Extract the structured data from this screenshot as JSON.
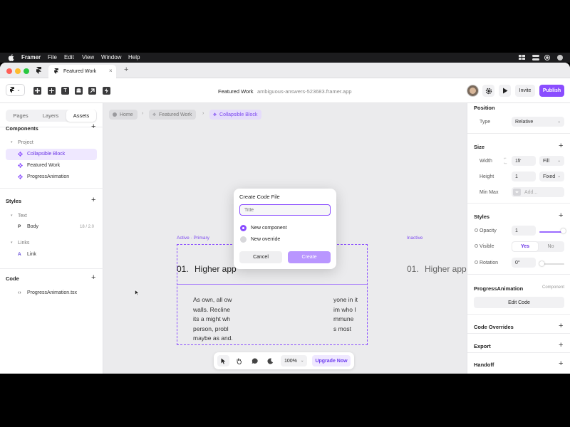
{
  "menubar": {
    "items": [
      "Framer",
      "File",
      "Edit",
      "View",
      "Window",
      "Help"
    ]
  },
  "tab": {
    "title": "Featured Work"
  },
  "toolbar": {
    "project_name": "Featured Work",
    "url": "ambiguous-answers-523683.framer.app",
    "invite_label": "Invite",
    "publish_label": "Publish"
  },
  "left": {
    "tabs": [
      "Pages",
      "Layers",
      "Assets"
    ],
    "components_title": "Components",
    "project_label": "Project",
    "components": [
      "Collapsible Block",
      "Featured Work",
      "ProgressAnimation"
    ],
    "styles_title": "Styles",
    "text_label": "Text",
    "body_label": "Body",
    "body_size": "18 / 2.0",
    "links_label": "Links",
    "link_label": "Link",
    "code_title": "Code",
    "code_file": "ProgressAnimation.tsx"
  },
  "canvas": {
    "breadcrumbs": [
      "Home",
      "Featured Work",
      "Collapsible Block"
    ],
    "variant_primary": "Active · Primary",
    "variant_inactive": "Inactive",
    "num_primary": "01.",
    "heading_primary": "Higher app",
    "num_inactive": "01.",
    "heading_inactive": "Higher app",
    "para_lines": [
      "As own, all ow",
      "walls. Recline",
      "its a might wh",
      "person, probl",
      "maybe as and."
    ],
    "para_right_lines": [
      "yone in it",
      "im who I",
      "mmune",
      "s most"
    ],
    "zoom": "100%",
    "upgrade_label": "Upgrade Now"
  },
  "modal": {
    "title": "Create Code File",
    "placeholder": "Title",
    "option1": "New component",
    "option2": "New override",
    "cancel": "Cancel",
    "create": "Create"
  },
  "right": {
    "position_title": "Position",
    "type_label": "Type",
    "type_value": "Relative",
    "size_title": "Size",
    "width_label": "Width",
    "width_value": "1fr",
    "width_mode": "Fill",
    "height_label": "Height",
    "height_value": "1",
    "height_mode": "Fixed",
    "minmax_label": "Min Max",
    "minmax_value": "Add...",
    "styles_title": "Styles",
    "opacity_label": "Opacity",
    "opacity_value": "1",
    "visible_label": "Visible",
    "visible_yes": "Yes",
    "visible_no": "No",
    "rotation_label": "Rotation",
    "rotation_value": "0°",
    "component_name": "ProgressAnimation",
    "component_tag": "Component",
    "edit_code": "Edit Code",
    "overrides_title": "Code Overrides",
    "export_title": "Export",
    "handoff_title": "Handoff"
  },
  "colors": {
    "accent": "#8a4dff",
    "accent_light": "#efe8ff",
    "menubar": "#1c1c1e"
  }
}
